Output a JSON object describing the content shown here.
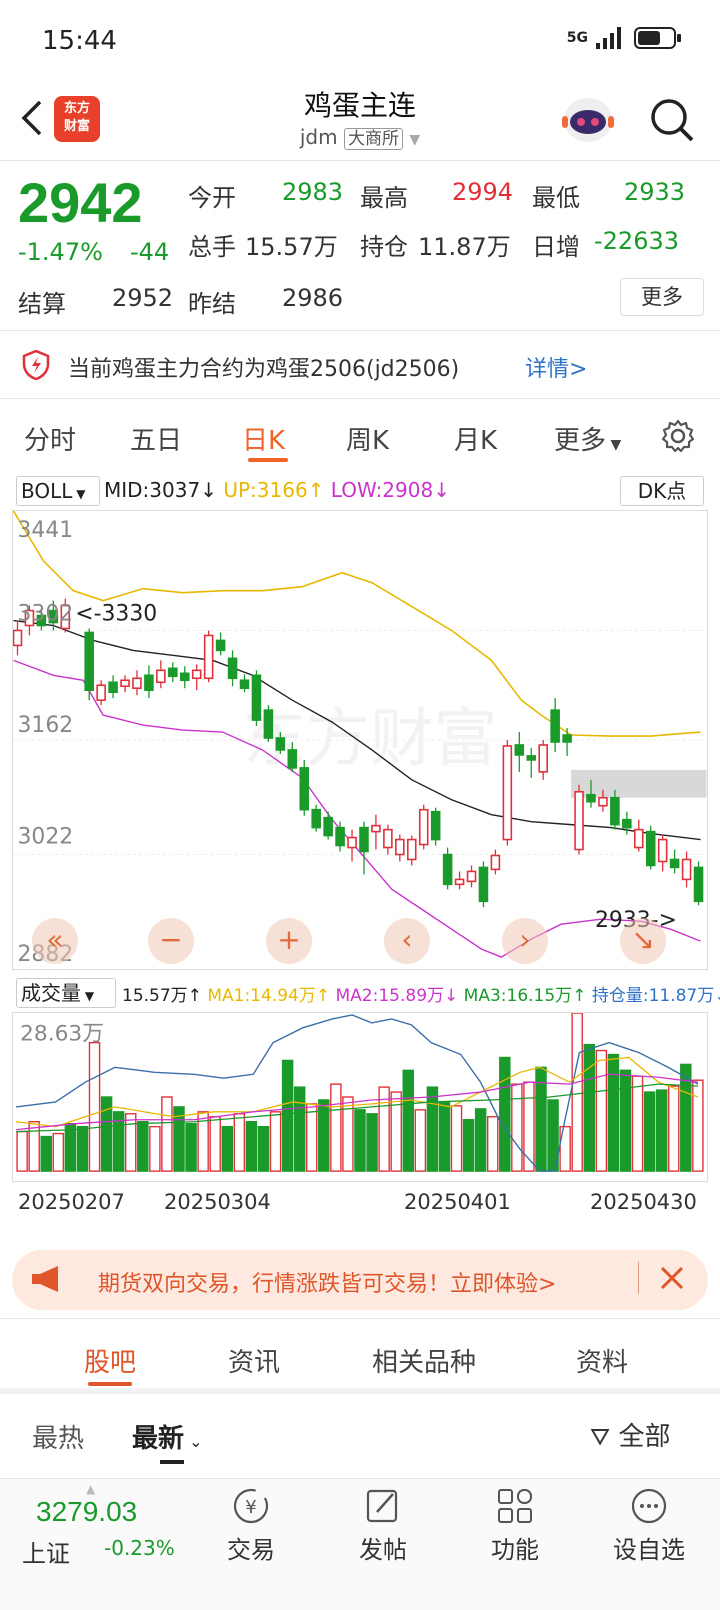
{
  "status": {
    "time": "15:44",
    "network": "5G"
  },
  "header": {
    "title": "鸡蛋主连",
    "code": "jdm",
    "exchange": "大商所",
    "logo_top": "东方",
    "logo_bottom": "财富"
  },
  "quote": {
    "price": "2942",
    "change_pct": "-1.47%",
    "change_abs": "-44",
    "open_label": "今开",
    "open": "2983",
    "high_label": "最高",
    "high": "2994",
    "low_label": "最低",
    "low": "2933",
    "volume_label": "总手",
    "volume": "15.57万",
    "oi_label": "持仓",
    "oi": "11.87万",
    "daily_inc_label": "日增",
    "daily_inc": "-22633",
    "settle_label": "结算",
    "settle": "2952",
    "prev_settle_label": "昨结",
    "prev_settle": "2986",
    "more_label": "更多"
  },
  "notice": {
    "text": "当前鸡蛋主力合约为鸡蛋2506(jd2506)",
    "link": "详情>"
  },
  "period_tabs": [
    "分时",
    "五日",
    "日K",
    "周K",
    "月K",
    "更多"
  ],
  "indicator": {
    "name": "BOLL",
    "mid": "MID:3037",
    "up": "UP:3166",
    "low": "LOW:2908",
    "dk": "DK点"
  },
  "kchart_labels": {
    "y1": "3441",
    "y2": "3302",
    "y3": "3162",
    "y4": "3022",
    "y5": "2882",
    "max_marker": "<-3330",
    "min_marker": "2933->",
    "watermark": "东方财富"
  },
  "volume": {
    "name": "成交量",
    "total": "15.57万",
    "ma1": "MA1:14.94万",
    "ma2": "MA2:15.89万",
    "ma3": "MA3:16.15万",
    "oi": "持仓量:11.87万",
    "y_top": "28.63万"
  },
  "dates": [
    "20250207",
    "20250304",
    "20250401",
    "20250430"
  ],
  "banner": {
    "text": "期货双向交易，行情涨跌皆可交易！立即体验>"
  },
  "content_tabs": [
    "股吧",
    "资讯",
    "相关品种",
    "资料"
  ],
  "sub_tabs": {
    "hot": "最热",
    "latest": "最新",
    "filter": "全部"
  },
  "bottom": {
    "index_value": "3279.03",
    "index_name": "上证",
    "index_change": "-0.23%",
    "nav": [
      "交易",
      "发帖",
      "功能",
      "设自选"
    ]
  },
  "colors": {
    "up": "#e0303a",
    "down": "#1a9a2a",
    "accent": "#f0642a",
    "boll_up": "#e8b800",
    "boll_low": "#cc33cc"
  }
}
